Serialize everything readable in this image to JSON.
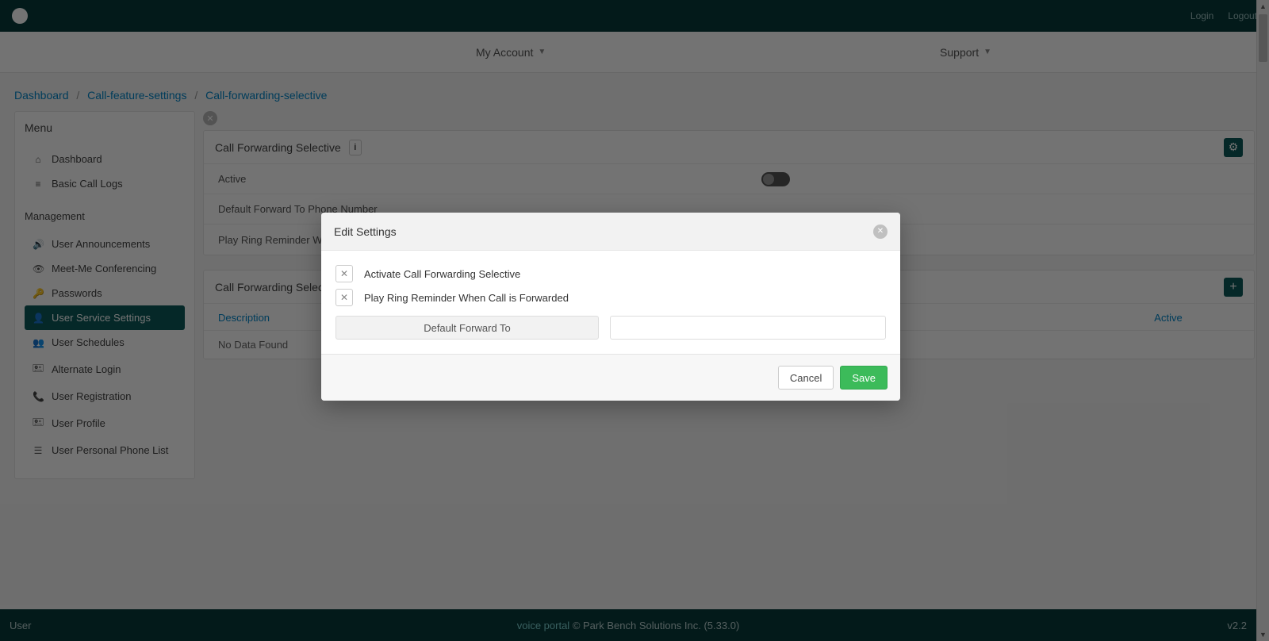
{
  "topbar": {
    "title": "",
    "login": "Login",
    "logout": "Logout"
  },
  "navbar": {
    "my_account": "My Account",
    "support": "Support"
  },
  "breadcrumb": {
    "a": "Dashboard",
    "b": "Call-feature-settings",
    "c": "Call-forwarding-selective",
    "sep": "/"
  },
  "sidebar": {
    "menu_title": "Menu",
    "mgmt_title": "Management",
    "items": {
      "dashboard": "Dashboard",
      "basic_call_logs": "Basic Call Logs",
      "user_announcements": "User Announcements",
      "meet_me": "Meet-Me Conferencing",
      "passwords": "Passwords",
      "user_service_settings": "User Service Settings",
      "user_schedules": "User Schedules",
      "alternate_login": "Alternate Login",
      "user_registration": "User Registration",
      "user_profile": "User Profile",
      "user_personal_phone_list": "User Personal Phone List"
    }
  },
  "panel1": {
    "title": "Call Forwarding Selective",
    "row_active": "Active",
    "row_default_forward": "Default Forward To Phone Number",
    "row_play_ring": "Play Ring Reminder When Call is Forwarded"
  },
  "panel2": {
    "title": "Call Forwarding Selective",
    "col_desc": "Description",
    "col_active": "Active",
    "no_data": "No Data Found"
  },
  "modal": {
    "title": "Edit Settings",
    "chk1": "Activate Call Forwarding Selective",
    "chk2": "Play Ring Reminder When Call is Forwarded",
    "field_label": "Default Forward To",
    "field_value": "",
    "cancel": "Cancel",
    "save": "Save"
  },
  "footer": {
    "left": "User",
    "mid_vp": "voice portal",
    "mid_rest": " © Park Bench Solutions Inc. (5.33.0)",
    "right": "v2.2"
  }
}
